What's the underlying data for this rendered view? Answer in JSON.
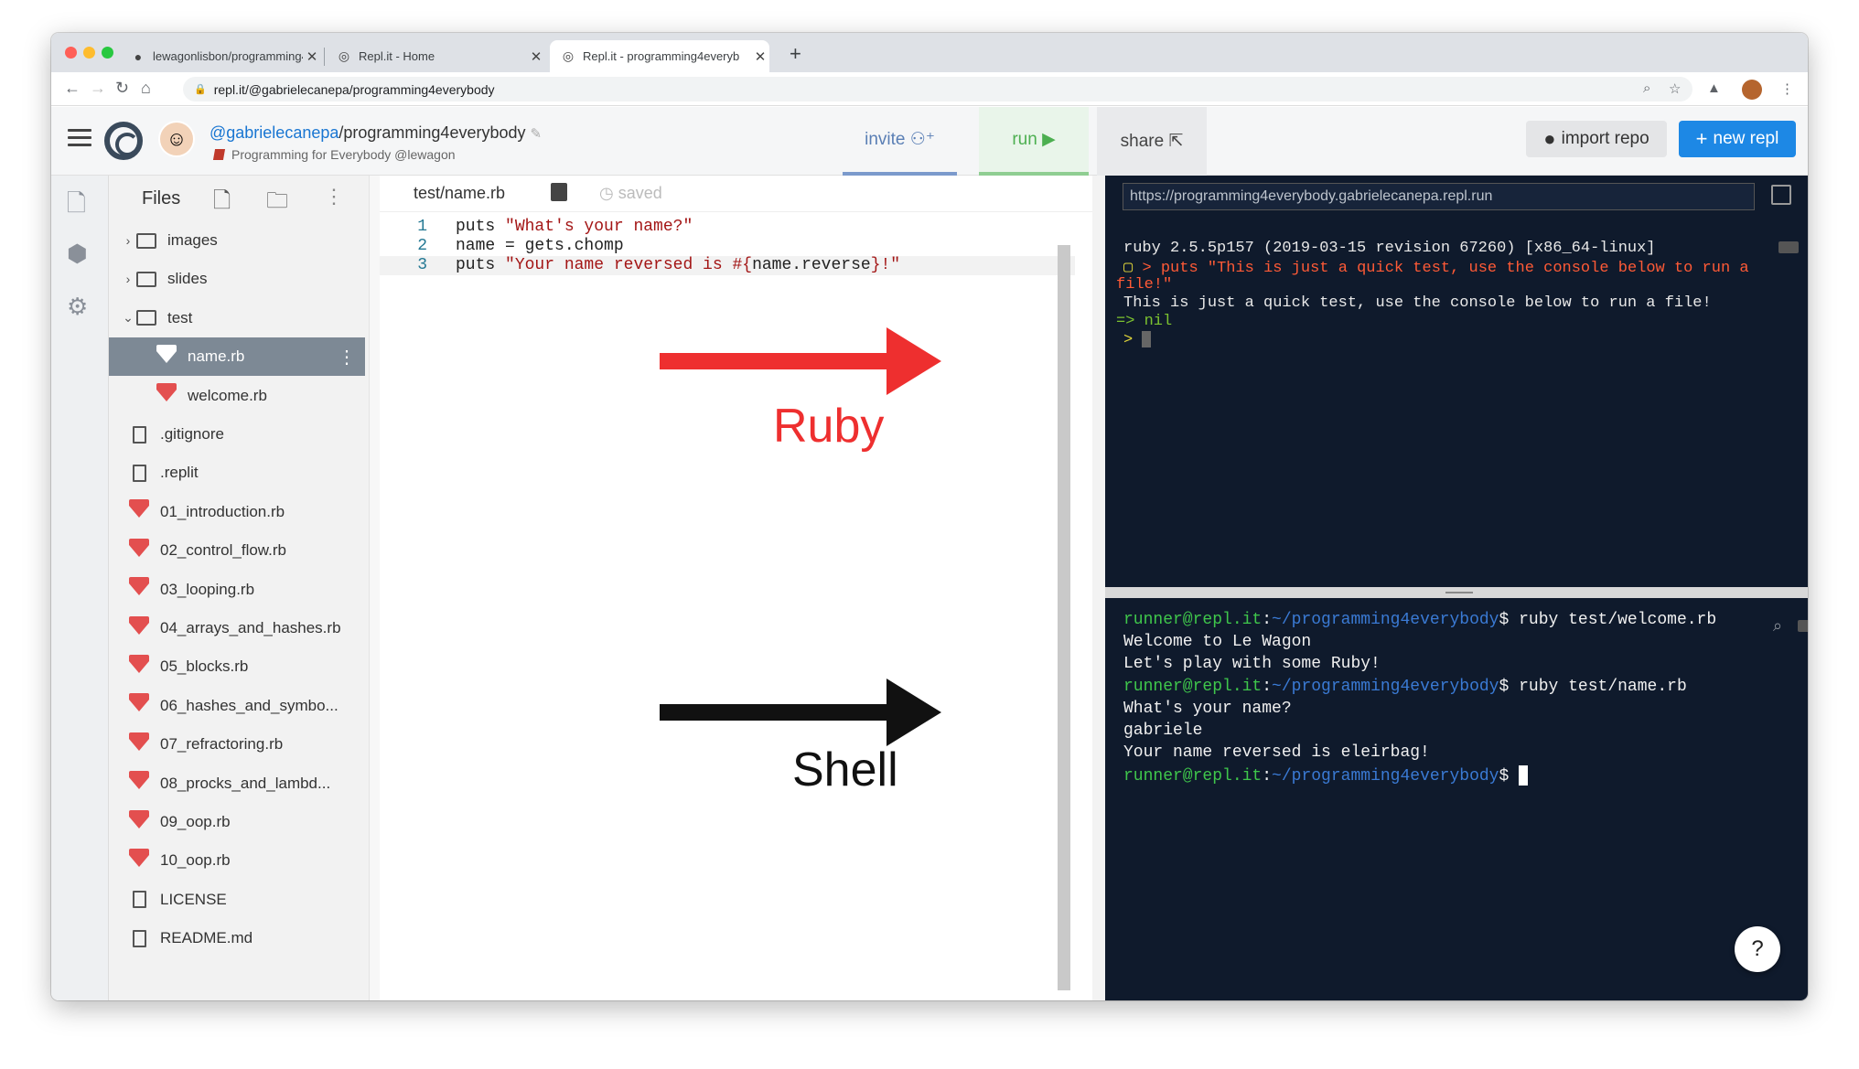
{
  "browser": {
    "tabs": [
      {
        "title": "lewagonlisbon/programming4e",
        "icon": "github-icon"
      },
      {
        "title": "Repl.it - Home",
        "icon": "replit-icon"
      },
      {
        "title": "Repl.it - programming4everyb",
        "icon": "replit-icon",
        "active": true
      }
    ],
    "url": "repl.it/@gabrielecanepa/programming4everybody"
  },
  "header": {
    "owner": "@gabrielecanepa",
    "repo": "programming4everybody",
    "subtitle": "Programming for Everybody @lewagon",
    "invite": "invite",
    "run": "run",
    "share": "share",
    "import_repo": "import repo",
    "new_repl": "new repl"
  },
  "files": {
    "title": "Files",
    "items": [
      {
        "name": "images",
        "type": "folder"
      },
      {
        "name": "slides",
        "type": "folder"
      },
      {
        "name": "test",
        "type": "folder-open"
      },
      {
        "name": "name.rb",
        "type": "ruby",
        "selected": true
      },
      {
        "name": "welcome.rb",
        "type": "ruby"
      },
      {
        "name": ".gitignore",
        "type": "file"
      },
      {
        "name": ".replit",
        "type": "file"
      },
      {
        "name": "01_introduction.rb",
        "type": "ruby"
      },
      {
        "name": "02_control_flow.rb",
        "type": "ruby"
      },
      {
        "name": "03_looping.rb",
        "type": "ruby"
      },
      {
        "name": "04_arrays_and_hashes.rb",
        "type": "ruby"
      },
      {
        "name": "05_blocks.rb",
        "type": "ruby"
      },
      {
        "name": "06_hashes_and_symbo...",
        "type": "ruby"
      },
      {
        "name": "07_refractoring.rb",
        "type": "ruby"
      },
      {
        "name": "08_procks_and_lambd...",
        "type": "ruby"
      },
      {
        "name": "09_oop.rb",
        "type": "ruby"
      },
      {
        "name": "10_oop.rb",
        "type": "ruby"
      },
      {
        "name": "LICENSE",
        "type": "file"
      },
      {
        "name": "README.md",
        "type": "file"
      }
    ]
  },
  "editor": {
    "tab_name": "test/name.rb",
    "status": "saved",
    "lines": [
      {
        "n": "1",
        "kw": "puts ",
        "str": "\"What's your name?\"",
        "rest": ""
      },
      {
        "n": "2",
        "kw": "name = gets.chomp",
        "str": "",
        "rest": ""
      },
      {
        "n": "3",
        "kw": "puts ",
        "str": "\"Your name reversed is #{",
        "rest": "name.reverse",
        "tail": "}!\""
      }
    ]
  },
  "annotations": {
    "ruby": "Ruby",
    "shell": "Shell"
  },
  "console": {
    "url": "https://programming4everybody.gabrielecanepa.repl.run",
    "version": "ruby 2.5.5p157 (2019-03-15 revision 67260) [x86_64-linux]",
    "input_line1": "> puts \"This is just a quick test, use the console below to run a",
    "input_line2": "file!\"",
    "output": "This is just a quick test, use the console below to run a file!",
    "result": "=> nil",
    "prompt": ">"
  },
  "shell": {
    "user": "runner@repl.it",
    "path": "~/programming4everybody",
    "lines": [
      {
        "cmd": "ruby test/welcome.rb"
      },
      {
        "out": "Welcome to Le Wagon"
      },
      {
        "out": "Let's play with some Ruby!"
      },
      {
        "cmd": "ruby test/name.rb"
      },
      {
        "out": "What's your name?"
      },
      {
        "out": "gabriele"
      },
      {
        "out": "Your name reversed is eleirbag!"
      },
      {
        "cmd": ""
      }
    ]
  },
  "help": "?"
}
